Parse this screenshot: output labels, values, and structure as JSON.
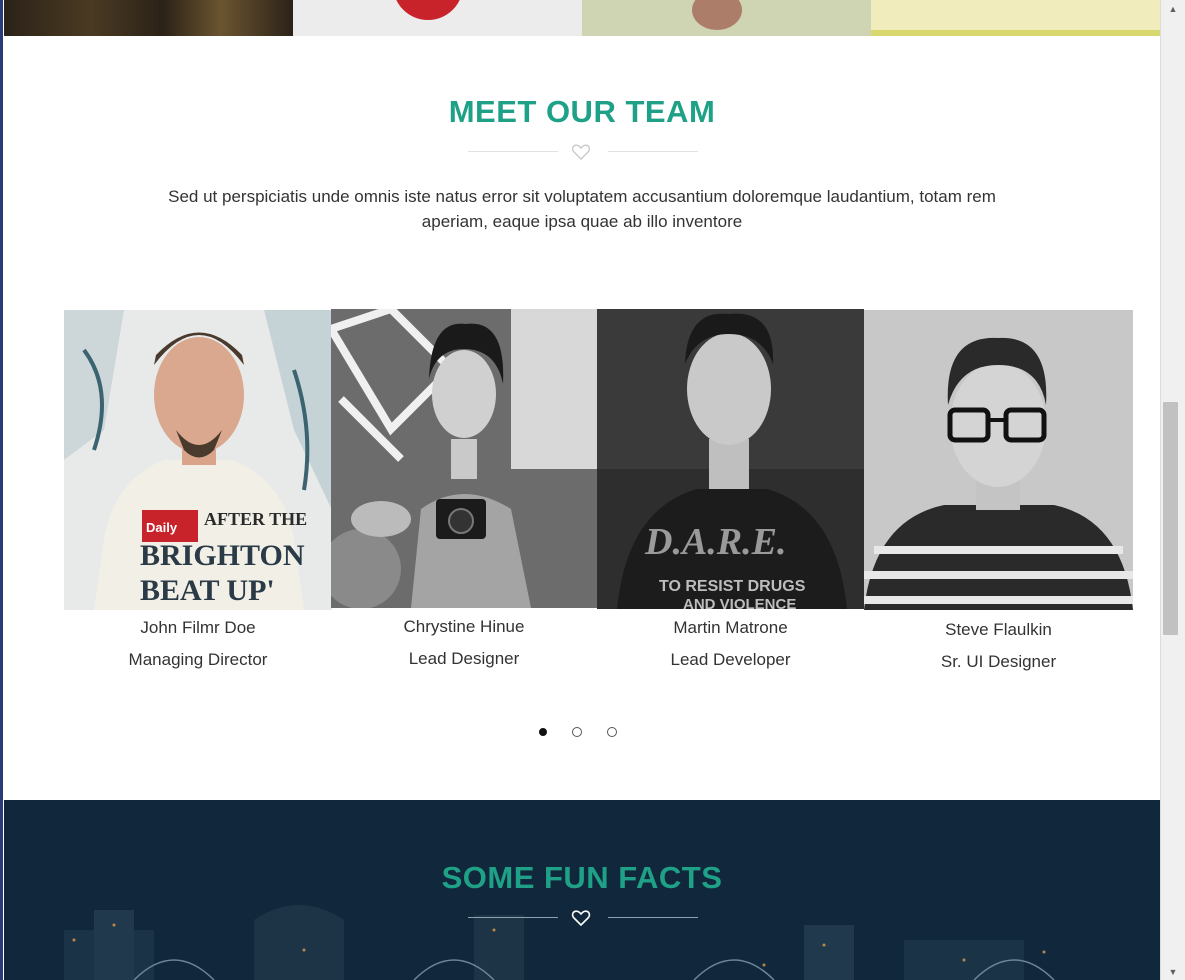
{
  "team": {
    "title": "MEET OUR TEAM",
    "intro": "Sed ut perspiciatis unde omnis iste natus error sit voluptatem accusantium doloremque laudantium, totam rem aperiam, eaque ipsa quae ab illo inventore",
    "members": [
      {
        "name": "John Filmr Doe",
        "role": "Managing Director"
      },
      {
        "name": "Chrystine Hinue",
        "role": "Lead Designer"
      },
      {
        "name": "Martin Matrone",
        "role": "Lead Developer"
      },
      {
        "name": "Steve Flaulkin",
        "role": "Sr. UI Designer"
      }
    ],
    "carousel": {
      "pages": 3,
      "active_page": 1
    }
  },
  "facts": {
    "title": "SOME FUN FACTS"
  },
  "colors": {
    "accent": "#1fa187",
    "facts_background": "#11283c"
  },
  "icons": {
    "divider": "heart-icon",
    "scroll_up": "arrow-up-icon",
    "scroll_down": "arrow-down-icon"
  }
}
